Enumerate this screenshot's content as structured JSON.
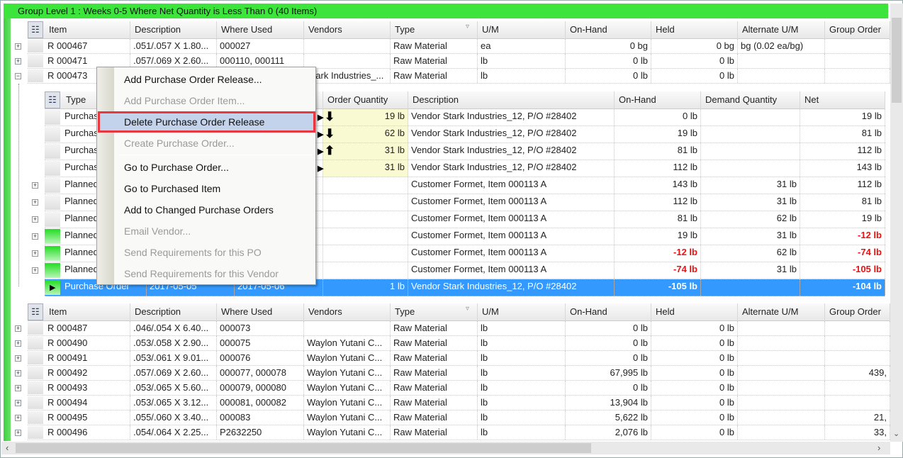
{
  "group": {
    "title": "Group Level 1 : Weeks 0-5 Where Net Quantity is Less Than 0 (40 Items)"
  },
  "columns": [
    "Item",
    "Description",
    "Where Used",
    "Vendors",
    "Type",
    "U/M",
    "On-Hand",
    "Held",
    "Alternate U/M",
    "Group Order"
  ],
  "rows_top": [
    {
      "item": "R 000467",
      "desc": ".051/.057 X 1.80...",
      "where": "000027",
      "vendors": "",
      "type": "Raw Material",
      "um": "ea",
      "onhand": "0 bg",
      "held": "0 bg",
      "alt": "bg (0.02 ea/bg)",
      "group": "",
      "expanded": false
    },
    {
      "item": "R 000471",
      "desc": ".057/.069 X 2.60...",
      "where": "000110, 000111",
      "vendors": "",
      "type": "Raw Material",
      "um": "lb",
      "onhand": "0 lb",
      "held": "0 lb",
      "alt": "",
      "group": "",
      "expanded": false
    },
    {
      "item": "R 000473",
      "desc": "",
      "where": "",
      "vendors": "Stark Industries_...",
      "type": "Raw Material",
      "um": "lb",
      "onhand": "0 lb",
      "held": "0 lb",
      "alt": "",
      "group": "",
      "expanded": true
    }
  ],
  "child": {
    "columns": [
      "Type",
      "",
      "",
      "Order Quantity",
      "Description",
      "On-Hand",
      "Demand Quantity",
      "Net"
    ],
    "rows": [
      {
        "type": "Purchase Order",
        "d1": "",
        "d2": "",
        "qty": "19 lb",
        "arrow": "down",
        "desc": "Vendor Stark Industries_12, P/O #28402",
        "onhand": "0 lb",
        "demand": "",
        "net": "19 lb",
        "green": false,
        "exp": false
      },
      {
        "type": "Purchase Order",
        "d1": "",
        "d2": "",
        "qty": "62 lb",
        "arrow": "down",
        "desc": "Vendor Stark Industries_12, P/O #28402",
        "onhand": "19 lb",
        "demand": "",
        "net": "81 lb",
        "green": false,
        "exp": false
      },
      {
        "type": "Purchase Order",
        "d1": "",
        "d2": "",
        "qty": "31 lb",
        "arrow": "up",
        "desc": "Vendor Stark Industries_12, P/O #28402",
        "onhand": "81 lb",
        "demand": "",
        "net": "112 lb",
        "green": false,
        "exp": false
      },
      {
        "type": "Purchase Order",
        "d1": "",
        "d2": "",
        "qty": "31 lb",
        "arrow": "",
        "desc": "Vendor Stark Industries_12, P/O #28402",
        "onhand": "112 lb",
        "demand": "",
        "net": "143 lb",
        "green": false,
        "exp": false
      },
      {
        "type": "Planned",
        "d1": "",
        "d2": "",
        "qty": "",
        "arrow": "",
        "desc": "Customer Formet, Item 000113 A",
        "onhand": "143 lb",
        "demand": "31 lb",
        "net": "112 lb",
        "green": false,
        "exp": true
      },
      {
        "type": "Planned",
        "d1": "",
        "d2": "",
        "qty": "",
        "arrow": "",
        "desc": "Customer Formet, Item 000113 A",
        "onhand": "112 lb",
        "demand": "31 lb",
        "net": "81 lb",
        "green": false,
        "exp": true
      },
      {
        "type": "Planned",
        "d1": "",
        "d2": "",
        "qty": "",
        "arrow": "",
        "desc": "Customer Formet, Item 000113 A",
        "onhand": "81 lb",
        "demand": "62 lb",
        "net": "19 lb",
        "green": false,
        "exp": true
      },
      {
        "type": "Planned",
        "d1": "",
        "d2": "",
        "qty": "",
        "arrow": "",
        "desc": "Customer Formet, Item 000113 A",
        "onhand": "19 lb",
        "demand": "31 lb",
        "net": "-12 lb",
        "green": true,
        "exp": true
      },
      {
        "type": "Planned",
        "d1": "",
        "d2": "",
        "qty": "",
        "arrow": "",
        "desc": "Customer Formet, Item 000113 A",
        "onhand": "-12 lb",
        "demand": "62 lb",
        "net": "-74 lb",
        "green": true,
        "exp": true
      },
      {
        "type": "Planned",
        "d1": "",
        "d2": "",
        "qty": "",
        "arrow": "",
        "desc": "Customer Formet, Item 000113 A",
        "onhand": "-74 lb",
        "demand": "31 lb",
        "net": "-105 lb",
        "green": true,
        "exp": true
      },
      {
        "type": "Purchase Order",
        "d1": "2017-05-05",
        "d2": "2017-05-06",
        "qty": "1 lb",
        "arrow": "",
        "desc": "Vendor Stark Industries_12, P/O #28402",
        "onhand": "-105 lb",
        "demand": "",
        "net": "-104 lb",
        "green": true,
        "exp": false,
        "selected": true
      }
    ]
  },
  "rows_bottom": [
    {
      "item": "R 000487",
      "desc": ".046/.054 X 6.40...",
      "where": "000073",
      "vendors": "",
      "type": "Raw Material",
      "um": "lb",
      "onhand": "0 lb",
      "held": "0 lb",
      "alt": "",
      "group": ""
    },
    {
      "item": "R 000490",
      "desc": ".053/.058 X 2.90...",
      "where": "000075",
      "vendors": "Waylon Yutani C...",
      "type": "Raw Material",
      "um": "lb",
      "onhand": "0 lb",
      "held": "0 lb",
      "alt": "",
      "group": ""
    },
    {
      "item": "R 000491",
      "desc": ".053/.061 X 9.01...",
      "where": "000076",
      "vendors": "Waylon Yutani C...",
      "type": "Raw Material",
      "um": "lb",
      "onhand": "0 lb",
      "held": "0 lb",
      "alt": "",
      "group": ""
    },
    {
      "item": "R 000492",
      "desc": ".057/.069 X 2.60...",
      "where": "000077, 000078",
      "vendors": "Waylon Yutani C...",
      "type": "Raw Material",
      "um": "lb",
      "onhand": "67,995 lb",
      "held": "0 lb",
      "alt": "",
      "group": "439,"
    },
    {
      "item": "R 000493",
      "desc": ".053/.065 X 5.60...",
      "where": "000079, 000080",
      "vendors": "Waylon Yutani C...",
      "type": "Raw Material",
      "um": "lb",
      "onhand": "0 lb",
      "held": "0 lb",
      "alt": "",
      "group": ""
    },
    {
      "item": "R 000494",
      "desc": ".053/.065 X 3.12...",
      "where": "000081, 000082",
      "vendors": "Waylon Yutani C...",
      "type": "Raw Material",
      "um": "lb",
      "onhand": "13,904 lb",
      "held": "0 lb",
      "alt": "",
      "group": ""
    },
    {
      "item": "R 000495",
      "desc": ".055/.060 X 3.40...",
      "where": "000083",
      "vendors": "Waylon Yutani C...",
      "type": "Raw Material",
      "um": "lb",
      "onhand": "5,622 lb",
      "held": "0 lb",
      "alt": "",
      "group": "21,"
    },
    {
      "item": "R 000496",
      "desc": ".054/.064 X 2.25...",
      "where": "P2632250",
      "vendors": "Waylon Yutani C...",
      "type": "Raw Material",
      "um": "lb",
      "onhand": "2,076 lb",
      "held": "0 lb",
      "alt": "",
      "group": "33,"
    }
  ],
  "context_menu": {
    "items": [
      {
        "label": "Add Purchase Order Release...",
        "enabled": true
      },
      {
        "label": "Add Purchase Order Item...",
        "enabled": false
      },
      {
        "label": "Delete Purchase Order Release",
        "enabled": true,
        "highlighted": true
      },
      {
        "label": "Create Purchase Order...",
        "enabled": false
      },
      {
        "label": "Go to Purchase Order...",
        "enabled": true
      },
      {
        "label": "Go to Purchased Item",
        "enabled": true
      },
      {
        "label": "Add to Changed Purchase Orders",
        "enabled": true
      },
      {
        "label": "Email Vendor...",
        "enabled": false
      },
      {
        "label": "Send Requirements for this PO",
        "enabled": false
      },
      {
        "label": "Send Requirements for this Vendor",
        "enabled": false
      }
    ]
  },
  "colors": {
    "group_header": "#3ce43c",
    "selection": "#3399ff",
    "negative": "#f01010",
    "highlight_border": "#e8383f"
  },
  "icons": {
    "expand": "plus-box",
    "collapse": "minus-box",
    "column_chooser": "column-chooser-icon",
    "sort": "filter-triangle",
    "row_pointer": "triangle-right"
  }
}
